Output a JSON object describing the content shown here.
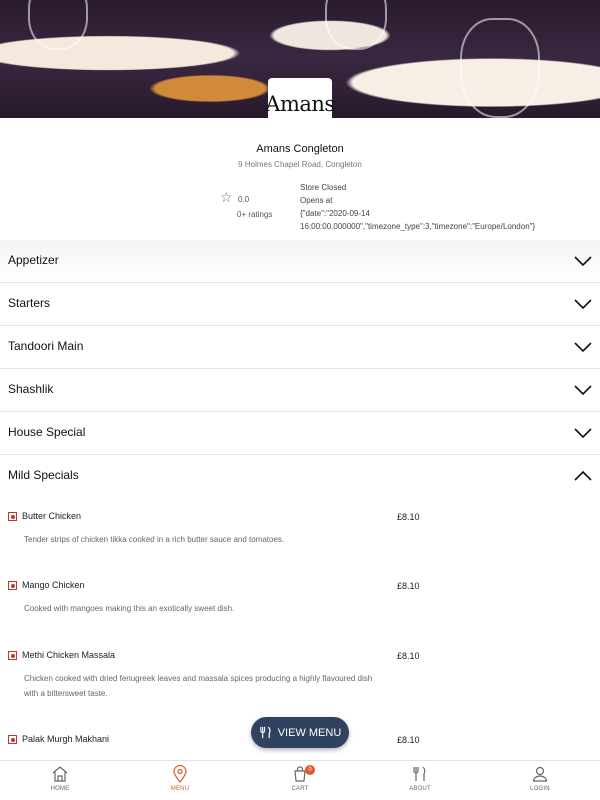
{
  "hero": {
    "logo_text": "Amans"
  },
  "store": {
    "name": "Amans Congleton",
    "address": "9 Holmes Chapel Road, Congleton",
    "rating_value": "0.0",
    "rating_count": "0+ ratings",
    "status_line1": "Store Closed",
    "status_line2": "Opens at",
    "status_line3": "{\"date\":\"2020-09-14",
    "status_line4": "16:00:00.000000\",\"timezone_type\":3,\"timezone\":\"Europe/London\"}"
  },
  "categories": [
    {
      "label": "Appetizer",
      "expanded": false
    },
    {
      "label": "Starters",
      "expanded": false
    },
    {
      "label": "Tandoori Main",
      "expanded": false
    },
    {
      "label": "Shashlik",
      "expanded": false
    },
    {
      "label": "House Special",
      "expanded": false
    },
    {
      "label": "Mild Specials",
      "expanded": true
    }
  ],
  "items": [
    {
      "name": "Butter Chicken",
      "price": "£8.10",
      "desc": "Tender strips of chicken tikka cooked in a rich butter sauce and tomatoes."
    },
    {
      "name": "Mango Chicken",
      "price": "£8.10",
      "desc": "Cooked with mangoes making this an exotically sweet dish."
    },
    {
      "name": "Methi Chicken Massala",
      "price": "£8.10",
      "desc": "Chicken cooked with dried fenugreek leaves and massala spices producing a highly flavoured dish with a bittersweet taste."
    },
    {
      "name": "Palak Murgh Makhani",
      "price": "£8.10",
      "desc": ""
    }
  ],
  "view_menu": {
    "label": "VIEW MENU"
  },
  "nav": {
    "home": "HOME",
    "menu": "MENU",
    "cart": "CART",
    "cart_count": "0",
    "about": "ABOUT",
    "login": "LOGIN",
    "active": "menu"
  },
  "colors": {
    "accent": "#e2582e",
    "button": "#2f4260",
    "veg_marker": "#c0392b"
  }
}
